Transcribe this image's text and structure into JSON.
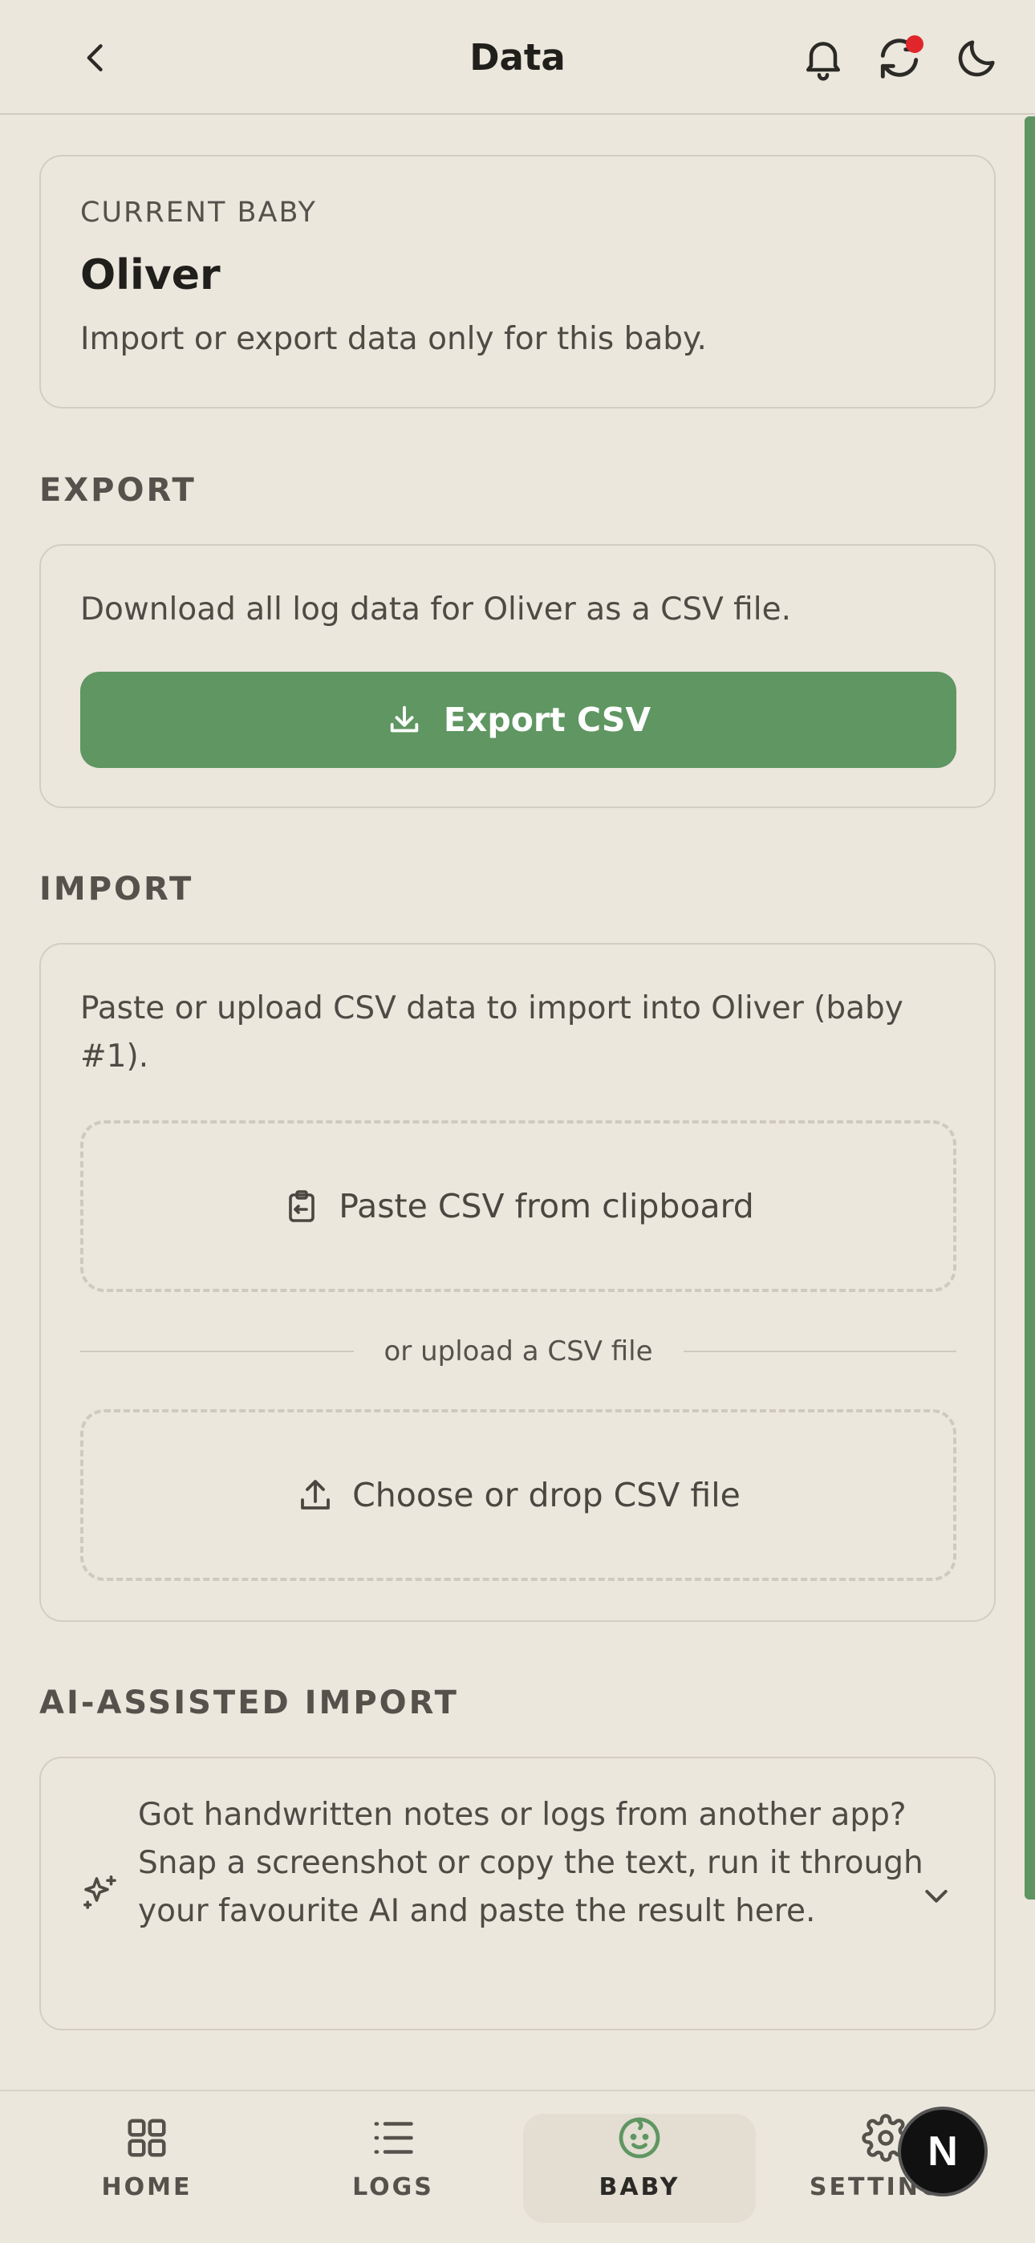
{
  "header": {
    "title": "Data"
  },
  "current_baby": {
    "eyebrow": "CURRENT BABY",
    "name": "Oliver",
    "description": "Import or export data only for this baby."
  },
  "export": {
    "section_label": "EXPORT",
    "description": "Download all log data for Oliver as a CSV file.",
    "button_label": "Export CSV"
  },
  "import": {
    "section_label": "IMPORT",
    "description": "Paste or upload CSV data to import into Oliver (baby #1).",
    "paste_label": "Paste CSV from clipboard",
    "divider_text": "or upload a CSV file",
    "upload_label": "Choose or drop CSV file"
  },
  "ai_import": {
    "section_label": "AI-ASSISTED IMPORT",
    "description": "Got handwritten notes or logs from another app? Snap a screenshot or copy the text, run it through your favourite AI and paste the result here."
  },
  "nav": {
    "items": [
      {
        "label": "HOME",
        "icon": "grid-icon"
      },
      {
        "label": "LOGS",
        "icon": "list-icon"
      },
      {
        "label": "BABY",
        "icon": "baby-icon",
        "active": true
      },
      {
        "label": "SETTINGS",
        "icon": "gear-icon"
      }
    ]
  },
  "fab": {
    "letter": "N"
  },
  "colors": {
    "accent": "#5f9662",
    "background": "#ebe7dd",
    "notification_dot": "#e0262b"
  }
}
